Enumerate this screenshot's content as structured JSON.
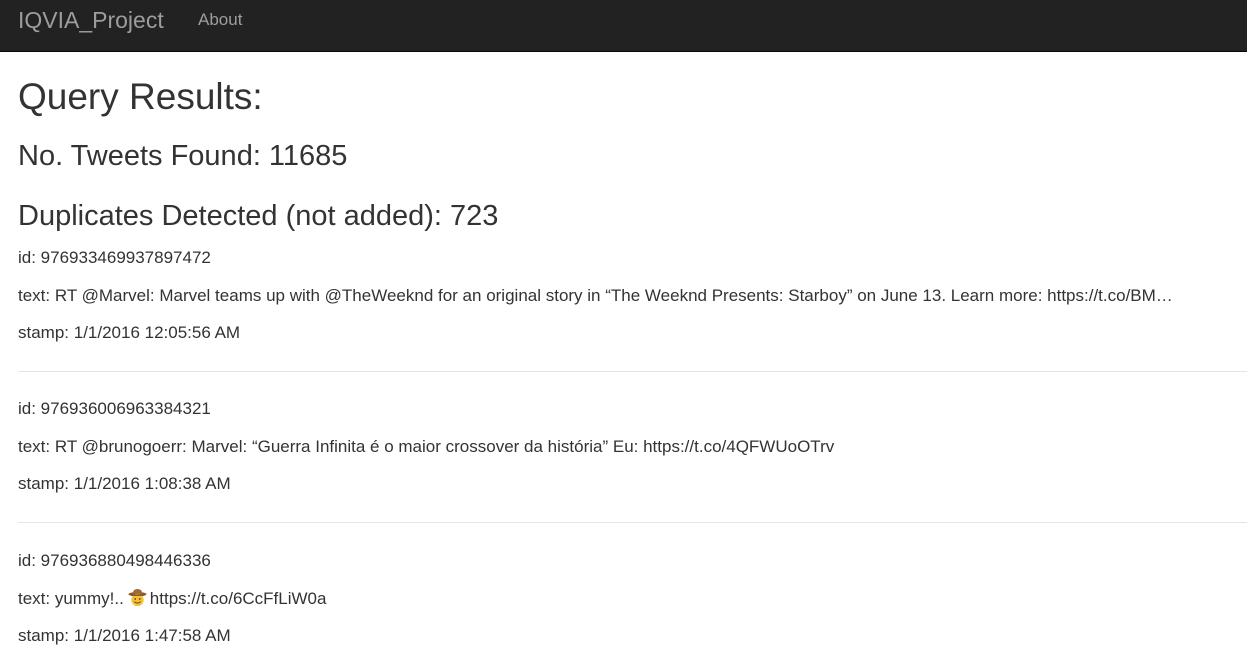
{
  "navbar": {
    "brand": "IQVIA_Project",
    "links": [
      "About"
    ]
  },
  "page": {
    "title": "Query Results:",
    "tweets_found": "No. Tweets Found: 11685",
    "duplicates": "Duplicates Detected (not added): 723"
  },
  "tweets": [
    {
      "id": "id: 976933469937897472",
      "text": "text: RT @Marvel: Marvel teams up with @TheWeeknd for an original story in “The Weeknd Presents: Starboy” on June 13. Learn more: https://t.co/BM…",
      "stamp": "stamp: 1/1/2016 12:05:56 AM"
    },
    {
      "id": "id: 976936006963384321",
      "text": "text: RT @brunogoerr: Marvel: “Guerra Infinita é o maior crossover da história” Eu: https://t.co/4QFWUoOTrv",
      "stamp": "stamp: 1/1/2016 1:08:38 AM"
    },
    {
      "id": "id: 976936880498446336",
      "text_before": "text: yummy!..",
      "text_after": "https://t.co/6CcFfLiW0a",
      "emoji": "cowboy-face-icon",
      "stamp": "stamp: 1/1/2016 1:47:58 AM"
    }
  ],
  "colors": {
    "navbar_bg": "#222222",
    "navbar_text": "#9d9d9d",
    "body_text": "#333333",
    "divider": "#e5e5e5"
  }
}
